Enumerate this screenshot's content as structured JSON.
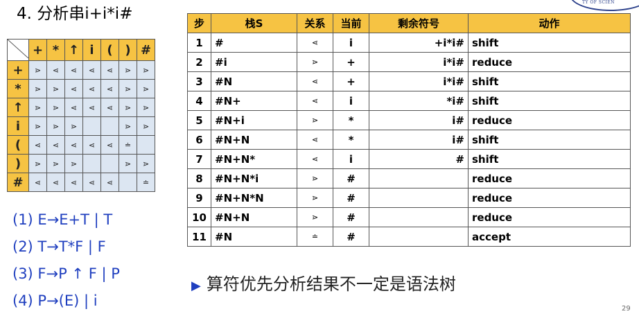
{
  "slide": {
    "title": "4.  分析串i+i*i#",
    "logo_text": "TY OF SCIEN",
    "page_number": "29"
  },
  "precedence": {
    "symbols": [
      "+",
      "*",
      "↑",
      "i",
      "(",
      ")",
      "#"
    ],
    "rows": [
      [
        "⋗",
        "⋖",
        "⋖",
        "⋖",
        "⋖",
        "⋗",
        "⋗"
      ],
      [
        "⋗",
        "⋗",
        "⋖",
        "⋖",
        "⋖",
        "⋗",
        "⋗"
      ],
      [
        "⋗",
        "⋗",
        "⋖",
        "⋖",
        "⋖",
        "⋗",
        "⋗"
      ],
      [
        "⋗",
        "⋗",
        "⋗",
        "",
        "",
        "⋗",
        "⋗"
      ],
      [
        "⋖",
        "⋖",
        "⋖",
        "⋖",
        "⋖",
        "≐",
        ""
      ],
      [
        "⋗",
        "⋗",
        "⋗",
        "",
        "",
        "⋗",
        "⋗"
      ],
      [
        "⋖",
        "⋖",
        "⋖",
        "⋖",
        "⋖",
        "",
        "≐"
      ]
    ]
  },
  "grammar": [
    "(1)  E→E+T | T",
    "(2)  T→T*F | F",
    "(3)  F→P ↑ F | P",
    "(4)  P→(E) | i"
  ],
  "analysis": {
    "headers": [
      "步",
      "栈S",
      "关系",
      "当前",
      "剩余符号",
      "动作"
    ],
    "rows": [
      [
        "1",
        "#",
        "⋖",
        "i",
        "+i*i#",
        "shift"
      ],
      [
        "2",
        "#i",
        "⋗",
        "+",
        "i*i#",
        "reduce"
      ],
      [
        "3",
        "#N",
        "⋖",
        "+",
        "i*i#",
        "shift"
      ],
      [
        "4",
        "#N+",
        "⋖",
        "i",
        "*i#",
        "shift"
      ],
      [
        "5",
        "#N+i",
        "⋗",
        "*",
        "i#",
        "reduce"
      ],
      [
        "6",
        "#N+N",
        "⋖",
        "*",
        "i#",
        "shift"
      ],
      [
        "7",
        "#N+N*",
        "⋖",
        "i",
        "#",
        "shift"
      ],
      [
        "8",
        "#N+N*i",
        "⋗",
        "#",
        "",
        "reduce"
      ],
      [
        "9",
        "#N+N*N",
        "⋗",
        "#",
        "",
        "reduce"
      ],
      [
        "10",
        "#N+N",
        "⋗",
        "#",
        "",
        "reduce"
      ],
      [
        "11",
        "#N",
        "≐",
        "#",
        "",
        "accept"
      ]
    ]
  },
  "note": "算符优先分析结果不一定是语法树",
  "icons": {
    "note_bullet": "triangle-right-icon",
    "corner": "diagonal-slash"
  }
}
